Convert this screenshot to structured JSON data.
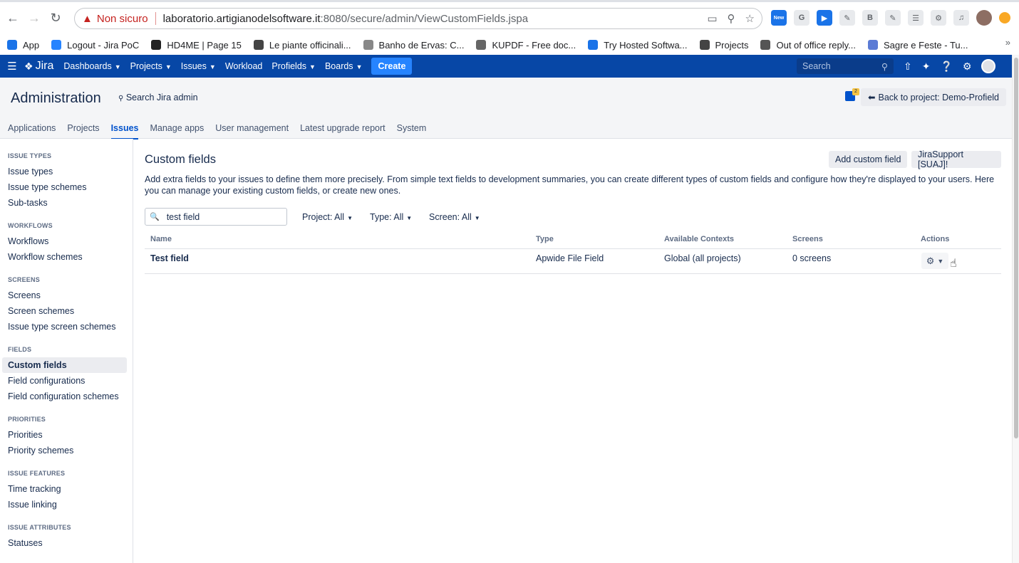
{
  "browser": {
    "security_label": "Non sicuro",
    "url_host": "laboratorio.artigianodelsoftware.it",
    "url_path": ":8080/secure/admin/ViewCustomFields.jspa",
    "ext_new_badge": "New",
    "bookmarks": [
      {
        "label": "App",
        "color": "#1a73e8"
      },
      {
        "label": "Logout - Jira PoC",
        "color": "#2684ff"
      },
      {
        "label": "HD4ME | Page 15",
        "color": "#222222"
      },
      {
        "label": "Le piante officinali...",
        "color": "#444444"
      },
      {
        "label": "Banho de Ervas: C...",
        "color": "#888888"
      },
      {
        "label": "KUPDF - Free doc...",
        "color": "#666666"
      },
      {
        "label": "Try Hosted Softwa...",
        "color": "#1a73e8"
      },
      {
        "label": "Projects",
        "color": "#444444"
      },
      {
        "label": "Out of office reply...",
        "color": "#555555"
      },
      {
        "label": "Sagre e Feste - Tu...",
        "color": "#5b7bd5"
      }
    ]
  },
  "jira_nav": {
    "logo": "Jira",
    "items": [
      "Dashboards",
      "Projects",
      "Issues",
      "Workload",
      "Profields",
      "Boards"
    ],
    "create_label": "Create",
    "search_placeholder": "Search"
  },
  "admin": {
    "title": "Administration",
    "search_label": "Search Jira admin",
    "back_label": "Back to project: Demo-Profield",
    "feedback_count": "2",
    "tabs": [
      "Applications",
      "Projects",
      "Issues",
      "Manage apps",
      "User management",
      "Latest upgrade report",
      "System"
    ],
    "active_tab": "Issues"
  },
  "sidebar": {
    "sections": [
      {
        "title": "ISSUE TYPES",
        "items": [
          "Issue types",
          "Issue type schemes",
          "Sub-tasks"
        ]
      },
      {
        "title": "WORKFLOWS",
        "items": [
          "Workflows",
          "Workflow schemes"
        ]
      },
      {
        "title": "SCREENS",
        "items": [
          "Screens",
          "Screen schemes",
          "Issue type screen schemes"
        ]
      },
      {
        "title": "FIELDS",
        "items": [
          "Custom fields",
          "Field configurations",
          "Field configuration schemes"
        ]
      },
      {
        "title": "PRIORITIES",
        "items": [
          "Priorities",
          "Priority schemes"
        ]
      },
      {
        "title": "ISSUE FEATURES",
        "items": [
          "Time tracking",
          "Issue linking"
        ]
      },
      {
        "title": "ISSUE ATTRIBUTES",
        "items": [
          "Statuses"
        ]
      }
    ],
    "active_item": "Custom fields"
  },
  "main": {
    "title": "Custom fields",
    "add_button": "Add custom field",
    "support_button": "JiraSupport [SUAJ]!",
    "description": "Add extra fields to your issues to define them more precisely. From simple text fields to development summaries, you can create different types of custom fields and configure how they're displayed to your users. Here you can manage your existing custom fields, or create new ones.",
    "filter": {
      "value": "test field",
      "project": "Project: All",
      "type": "Type: All",
      "screen": "Screen: All"
    },
    "columns": [
      "Name",
      "Type",
      "Available Contexts",
      "Screens",
      "Actions"
    ],
    "rows": [
      {
        "name": "Test field",
        "type": "Apwide File Field",
        "contexts": "Global (all projects)",
        "screens": "0 screens"
      }
    ]
  }
}
